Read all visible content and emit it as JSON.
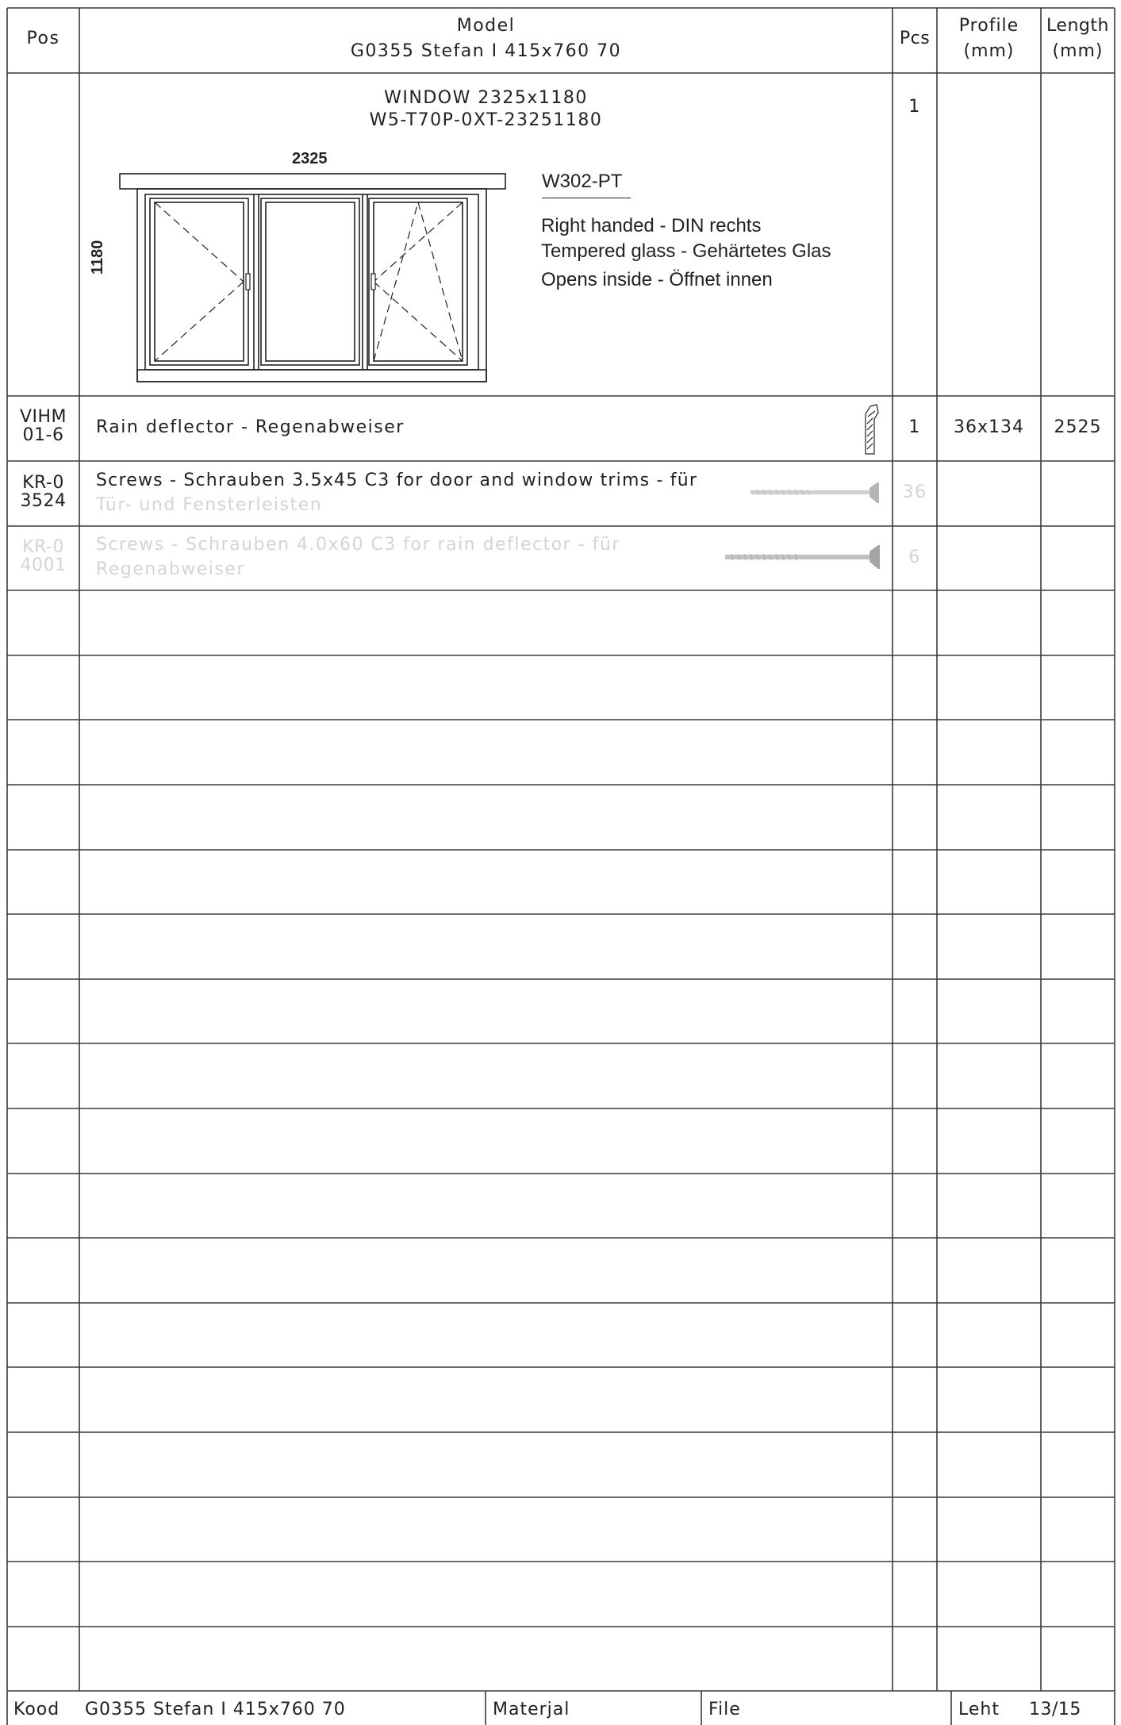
{
  "header": {
    "pos": "Pos",
    "model": "Model",
    "model_code": "G0355 Stefan I 415x760 70",
    "pcs": "Pcs",
    "profile": "Profile",
    "profile_unit": "(mm)",
    "length": "Length",
    "length_unit": "(mm)"
  },
  "window": {
    "title": "WINDOW 2325x1180",
    "code": "W5-T70P-0XT-23251180",
    "pcs": "1",
    "width_dim": "2325",
    "height_dim": "1180",
    "type_label": "W302-PT",
    "notes": [
      "Right handed - DIN rechts",
      "Tempered glass - Gehärtetes Glas",
      "Opens inside - Öffnet innen"
    ]
  },
  "rows": [
    {
      "pos_line1": "VIHM",
      "pos_line2": "01-6",
      "desc_line1": "Rain deflector - Regenabweiser",
      "desc_line2": "",
      "pcs": "1",
      "profile": "36x134",
      "length": "2525",
      "icon": "rain-deflector-profile-icon"
    },
    {
      "pos_line1": "KR-0",
      "pos_line2": "3524",
      "desc_line1": "Screws - Schrauben 3.5x45 C3   for door and window trims - für",
      "desc_line2": "Tür- und Fensterleisten",
      "pcs": "36",
      "profile": "",
      "length": "",
      "icon": "screw-icon"
    },
    {
      "pos_line1": "KR-0",
      "pos_line2": "4001",
      "desc_line1": "Screws - Schrauben 4.0x60 C3   for rain deflector - für",
      "desc_line2": "Regenabweiser",
      "pcs": "6",
      "profile": "",
      "length": "",
      "icon": "screw-icon"
    }
  ],
  "footer": {
    "kood_label": "Kood",
    "kood_value": "G0355 Stefan I 415x760 70",
    "materjal_label": "Materjal",
    "file_label": "File",
    "leht_label": "Leht",
    "leht_value": "13/15"
  }
}
